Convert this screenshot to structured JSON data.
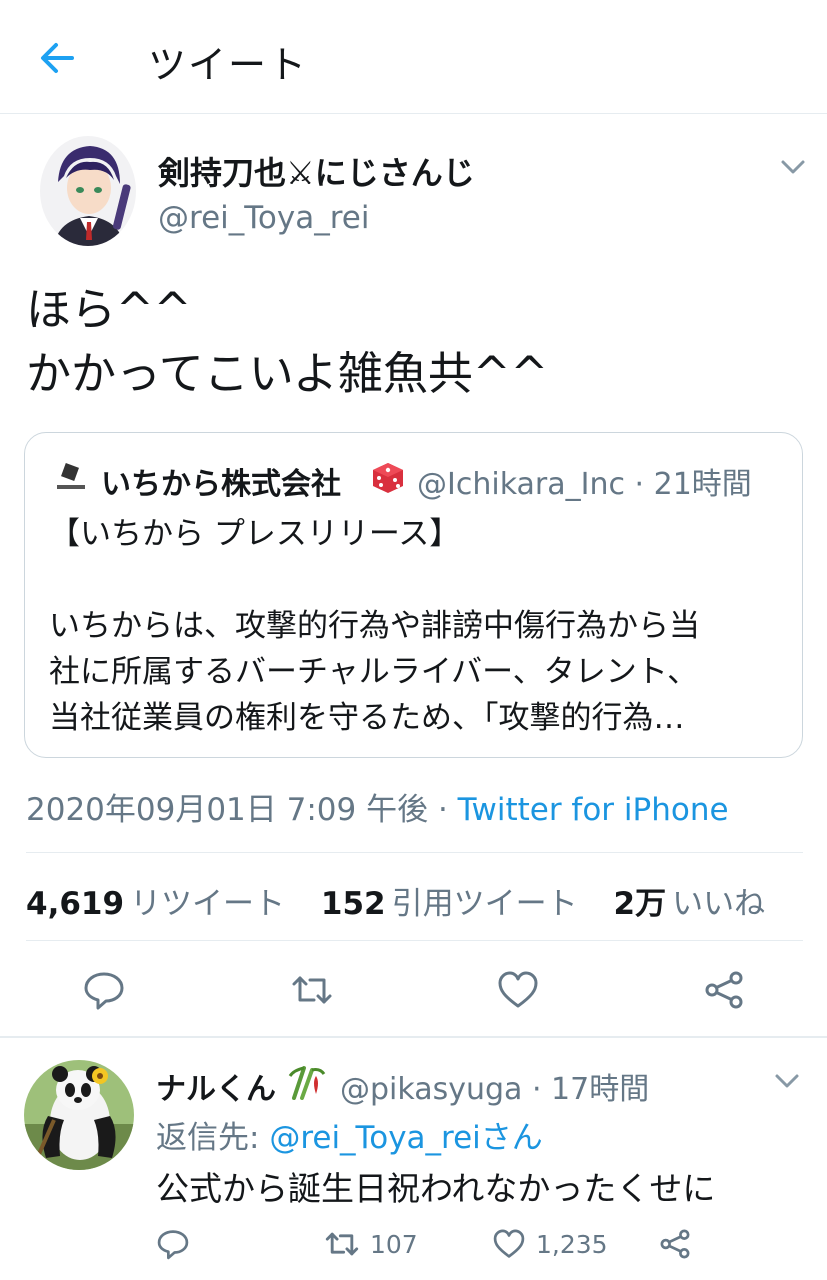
{
  "header": {
    "title": "ツイート",
    "back_icon": "arrow-left-icon"
  },
  "tweet": {
    "display_name": "剣持刀也⚔にじさんじ",
    "handle": "@rei_Toya_rei",
    "text_lines": [
      "ほら^^",
      "かかってこいよ雑魚共^^"
    ],
    "quote": {
      "name": "いちから株式会社",
      "handle": "@Ichikara_Inc",
      "time": "21時間",
      "separator": " · ",
      "lines": [
        "【いちから プレスリリース】",
        "",
        "いちからは、攻撃的行為や誹謗中傷行為から当",
        "社に所属するバーチャルライバー、タレント、",
        "当社従業員の権利を守るため、「攻撃的行為…"
      ]
    },
    "timestamp": "2020年09月01日 7:09 午後",
    "separator": " · ",
    "source": "Twitter for iPhone",
    "stats": {
      "retweets": "4,619",
      "retweets_label": "リツイート",
      "quotes": "152",
      "quotes_label": "引用ツイート",
      "likes": "2万",
      "likes_label": "いいね"
    }
  },
  "reply": {
    "display_name": "ナルくん",
    "handle": "@pikasyuga",
    "time": "17時間",
    "separator": " · ",
    "reply_to_prefix": "返信先: ",
    "reply_to_mention": "@rei_Toya_reiさん",
    "text": "公式から誕生日祝われなかったくせに",
    "retweets": "107",
    "likes": "1,235"
  },
  "colors": {
    "accent": "#1b95e0",
    "secondary_text": "#657786",
    "border": "#e6ecf0"
  }
}
